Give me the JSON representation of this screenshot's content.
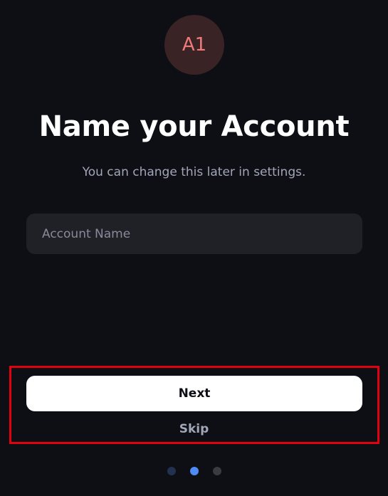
{
  "avatar": {
    "initials": "A1",
    "bg_color": "#3a2325",
    "text_color": "#f0797a"
  },
  "header": {
    "title": "Name your Account",
    "subtitle": "You can change this later in settings."
  },
  "form": {
    "account_name_placeholder": "Account Name",
    "account_name_value": ""
  },
  "actions": {
    "next_label": "Next",
    "skip_label": "Skip"
  },
  "pagination": {
    "total_steps": 3,
    "current_step": 2,
    "dots": [
      {
        "state": "completed",
        "color": "#233150"
      },
      {
        "state": "active",
        "color": "#4d8bf5"
      },
      {
        "state": "upcoming",
        "color": "#3a3b42"
      }
    ]
  },
  "colors": {
    "background": "#0e0f14",
    "input_bg": "#202127",
    "highlight": "#e3000f"
  }
}
